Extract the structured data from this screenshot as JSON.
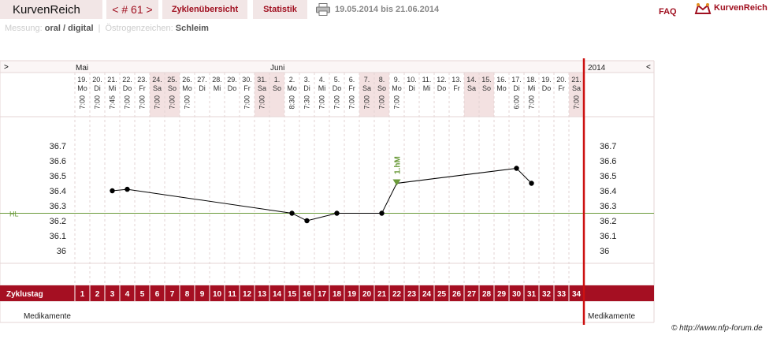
{
  "header": {
    "app_title": "KurvenReich",
    "cycle_nav": "< # 61 >",
    "tabs": [
      "Zyklenübersicht",
      "Statistik"
    ],
    "date_range": "19.05.2014 bis 21.06.2014",
    "faq": "FAQ",
    "brand": "KurvenReich",
    "print_icon": "printer-icon",
    "brand_icon": "crown-logo-icon"
  },
  "meta": {
    "measurement_label": "Messung:",
    "measurement_value": "oral / digital",
    "estrogen_label": "Östrogenzeichen:",
    "estrogen_value": "Schleim"
  },
  "chart_data": {
    "type": "line",
    "months": [
      {
        "label": "Mai",
        "start_index": 0
      },
      {
        "label": "Juni",
        "start_index": 13
      }
    ],
    "year": "2014",
    "nav_left": ">",
    "nav_right": "<",
    "days": [
      "19.",
      "20.",
      "21.",
      "22.",
      "23.",
      "24.",
      "25.",
      "26.",
      "27.",
      "28.",
      "29.",
      "30.",
      "31.",
      "1.",
      "2.",
      "3.",
      "4.",
      "5.",
      "6.",
      "7.",
      "8.",
      "9.",
      "10.",
      "11.",
      "12.",
      "13.",
      "14.",
      "15.",
      "16.",
      "17.",
      "18.",
      "19.",
      "20.",
      "21."
    ],
    "weekdays": [
      "Mo",
      "Di",
      "Mi",
      "Do",
      "Fr",
      "Sa",
      "So",
      "Mo",
      "Di",
      "Mi",
      "Do",
      "Fr",
      "Sa",
      "So",
      "Mo",
      "Di",
      "Mi",
      "Do",
      "Fr",
      "Sa",
      "So",
      "Mo",
      "Di",
      "Mi",
      "Do",
      "Fr",
      "Sa",
      "So",
      "Mo",
      "Di",
      "Mi",
      "Do",
      "Fr",
      "Sa"
    ],
    "times": [
      "7:00",
      "7:00",
      "7:45",
      "7:00",
      "7:00",
      "7:00",
      "7:00",
      "7:00",
      "",
      "",
      "",
      "7:00",
      "7:00",
      "",
      "8:30",
      "7:30",
      "7:00",
      "7:00",
      "7:00",
      "7:00",
      "7:00",
      "7:00",
      "",
      "",
      "",
      "",
      "",
      "",
      "",
      "6:00",
      "7:00",
      "",
      "",
      "7:00"
    ],
    "cycle_days": [
      "1",
      "2",
      "3",
      "4",
      "5",
      "6",
      "7",
      "8",
      "9",
      "10",
      "11",
      "12",
      "13",
      "14",
      "15",
      "16",
      "17",
      "18",
      "19",
      "20",
      "21",
      "22",
      "23",
      "24",
      "25",
      "26",
      "27",
      "28",
      "29",
      "30",
      "31",
      "32",
      "33",
      "34"
    ],
    "temperature_points": [
      {
        "day": 3,
        "value": 36.4
      },
      {
        "day": 4,
        "value": 36.41
      },
      {
        "day": 15,
        "value": 36.25
      },
      {
        "day": 16,
        "value": 36.2
      },
      {
        "day": 18,
        "value": 36.25
      },
      {
        "day": 21,
        "value": 36.25
      },
      {
        "day": 22,
        "value": 36.45
      },
      {
        "day": 30,
        "value": 36.55
      },
      {
        "day": 31,
        "value": 36.45
      }
    ],
    "y_ticks": [
      "36.7",
      "36.6",
      "36.5",
      "36.4",
      "36.3",
      "36.2",
      "36.1",
      "36"
    ],
    "ylim": [
      35.95,
      36.75
    ],
    "coverline": {
      "label": "HL",
      "value": 36.25,
      "color": "#6a9a3a"
    },
    "marker": {
      "label": "1.hM",
      "day": 22
    },
    "row_labels": {
      "cycle": "Zyklustag",
      "meds": "Medikamente"
    },
    "line_color": "#000000",
    "accent_color": "#a50f22"
  },
  "footer": {
    "credit": "© http://www.nfp-forum.de"
  }
}
